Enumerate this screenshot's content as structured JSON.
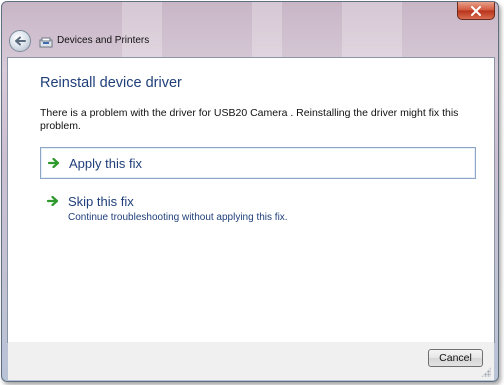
{
  "window": {
    "breadcrumb": "Devices and Printers",
    "close_icon": "close-x-icon",
    "back_icon": "back-arrow-icon"
  },
  "dialog": {
    "title": "Reinstall device driver",
    "description": "There is a problem with the driver for USB20 Camera    . Reinstalling the driver might fix this problem.",
    "options": [
      {
        "title": "Apply this fix",
        "subtitle": ""
      },
      {
        "title": "Skip this fix",
        "subtitle": "Continue troubleshooting without applying this fix."
      }
    ],
    "cancel_label": "Cancel"
  },
  "colors": {
    "link_blue": "#1f3f7a",
    "arrow_green": "#2e9a2e",
    "close_red": "#c8462a"
  }
}
